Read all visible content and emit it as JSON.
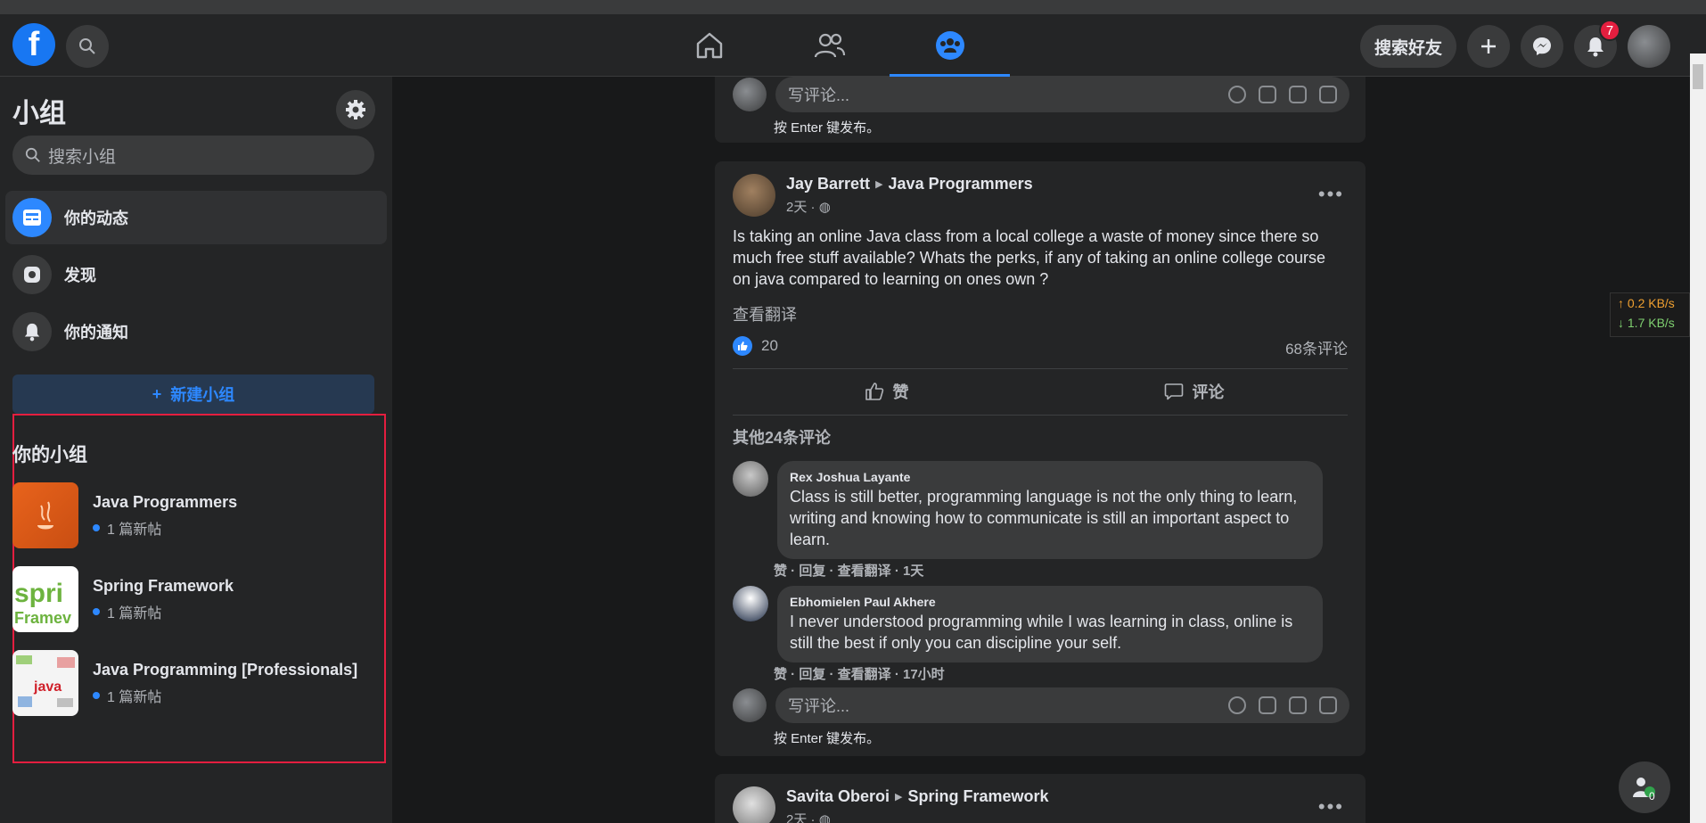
{
  "nav": {
    "find_friends": "搜索好友",
    "notification_count": "7"
  },
  "sidebar": {
    "title": "小组",
    "search_placeholder": "搜索小组",
    "items": [
      {
        "label": "你的动态",
        "icon": "feed-icon"
      },
      {
        "label": "发现",
        "icon": "compass-icon"
      },
      {
        "label": "你的通知",
        "icon": "bell-icon"
      }
    ],
    "create_group": "新建小组",
    "your_groups_title": "你的小组",
    "groups": [
      {
        "name": "Java Programmers",
        "meta": "1 篇新帖"
      },
      {
        "name": "Spring Framework",
        "meta": "1 篇新帖"
      },
      {
        "name": "Java Programming [Professionals]",
        "meta": "1 篇新帖"
      }
    ]
  },
  "top_card": {
    "comment_placeholder": "写评论...",
    "enter_hint": "按 Enter 键发布。"
  },
  "post": {
    "author": "Jay Barrett",
    "group": "Java Programmers",
    "time": "2天 · ",
    "body": "Is taking an online Java class from a local college a waste of money since there so much free stuff available? Whats the perks, if any of taking an online college course on java compared to learning on ones own ?",
    "see_translation": "查看翻译",
    "like_count": "20",
    "comment_count": "68条评论",
    "like_label": "赞",
    "comment_label": "评论",
    "other_comments": "其他24条评论",
    "comments": [
      {
        "name": "Rex Joshua Layante",
        "text": "Class is still better, programming language is not the only thing to learn, writing and knowing how to communicate is still an important aspect to learn.",
        "actions": "赞 · 回复 · 查看翻译 · 1天"
      },
      {
        "name": "Ebhomielen Paul Akhere",
        "text": "I never understood programming while I was learning in class, online is still the best if only you can discipline your self.",
        "actions": "赞 · 回复 · 查看翻译 · 17小时"
      }
    ],
    "comment_placeholder": "写评论...",
    "enter_hint": "按 Enter 键发布。"
  },
  "next_post": {
    "author": "Savita Oberoi",
    "group": "Spring Framework",
    "time": "2天 · "
  },
  "speed": {
    "up": "↑ 0.2 KB/s",
    "down": "↓ 1.7 KB/s"
  },
  "fab_count": "0",
  "colors": {
    "accent": "#2d88ff",
    "highlight": "#e41e3f",
    "badge": "#e41e3f"
  }
}
